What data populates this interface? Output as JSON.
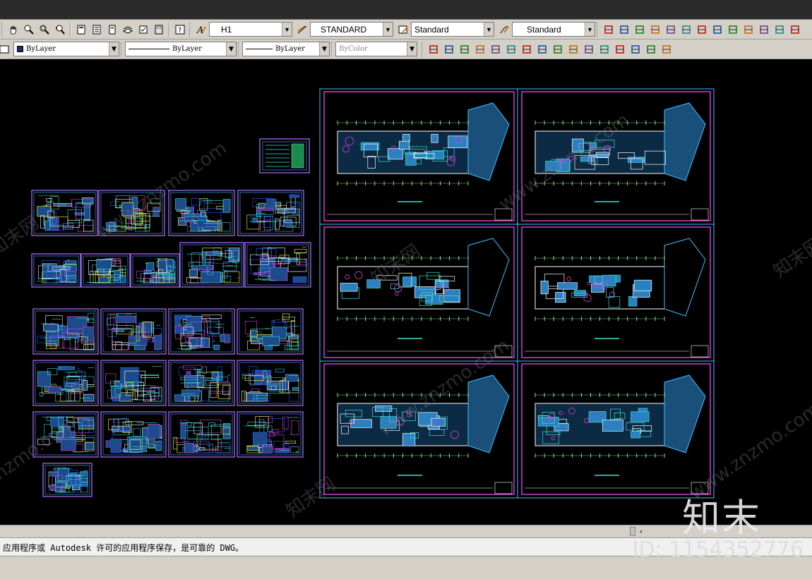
{
  "toolbar1": {
    "text_style": "H1",
    "dim_style": "STANDARD",
    "table_style": "Standard",
    "multileader_style": "Standard"
  },
  "toolbar2": {
    "layer_color": "ByLayer",
    "linetype": "ByLayer",
    "lineweight": "ByLayer",
    "plot_style": "ByColor"
  },
  "command_line": {
    "text": "应用程序或 Autodesk 许可的应用程序保存，是可靠的 DWG。"
  },
  "watermark": {
    "site": "znzmo.com",
    "site_full": "www.znzmo.com",
    "cn": "知末网",
    "logo": "知末",
    "id": "ID: 1154352776"
  },
  "icons": [
    "pan-icon",
    "zoom-realtime-icon",
    "zoom-window-icon",
    "zoom-previous-icon",
    "properties-icon",
    "design-center-icon",
    "tool-palettes-icon",
    "sheet-set-icon",
    "markup-icon",
    "calculator-icon",
    "help-icon",
    "text-style-icon",
    "dim-style-icon",
    "table-style-icon",
    "mleader-style-icon",
    "layer-tools-icon"
  ],
  "colors": {
    "cyan": "#3ec0ff",
    "magenta": "#e040e0",
    "toolbar": "#d4d0c8"
  }
}
